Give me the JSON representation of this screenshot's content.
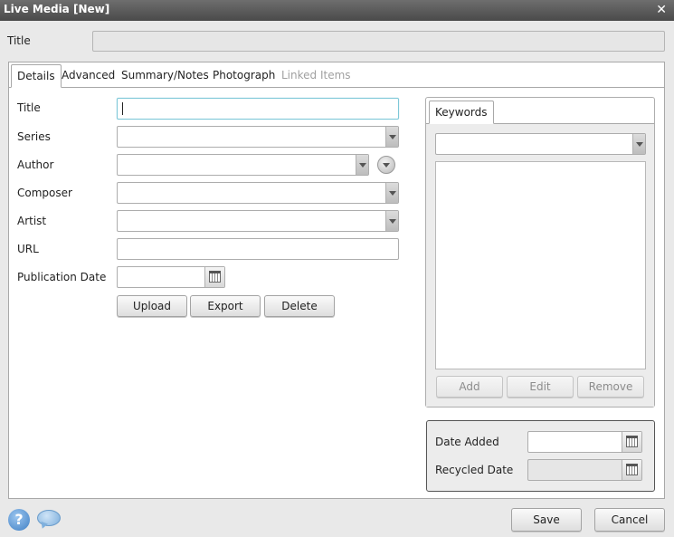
{
  "window": {
    "title": "Live Media [New]",
    "close_glyph": "✕"
  },
  "header": {
    "title_label": "Title",
    "title_value": ""
  },
  "tabs": [
    {
      "label": "Details",
      "state": "active"
    },
    {
      "label": "Advanced",
      "state": "normal"
    },
    {
      "label": "Summary/Notes",
      "state": "normal"
    },
    {
      "label": "Photograph",
      "state": "normal"
    },
    {
      "label": "Linked Items",
      "state": "disabled"
    }
  ],
  "details": {
    "title": {
      "label": "Title",
      "value": ""
    },
    "series": {
      "label": "Series",
      "value": ""
    },
    "author": {
      "label": "Author",
      "value": ""
    },
    "composer": {
      "label": "Composer",
      "value": ""
    },
    "artist": {
      "label": "Artist",
      "value": ""
    },
    "url": {
      "label": "URL",
      "value": ""
    },
    "publication_date": {
      "label": "Publication Date",
      "value": ""
    },
    "buttons": {
      "upload": "Upload",
      "export": "Export",
      "delete": "Delete"
    }
  },
  "keywords": {
    "tab_label": "Keywords",
    "selected": "",
    "items": [],
    "buttons": {
      "add": "Add",
      "edit": "Edit",
      "remove": "Remove"
    }
  },
  "dates": {
    "date_added": {
      "label": "Date Added",
      "value": ""
    },
    "recycled_date": {
      "label": "Recycled Date",
      "value": ""
    }
  },
  "footer": {
    "save": "Save",
    "cancel": "Cancel",
    "help_glyph": "?"
  },
  "icons": {
    "close": "close-icon",
    "dropdown": "chevron-down-icon",
    "calendar": "calendar-icon",
    "help": "help-icon",
    "chat": "chat-bubble-icon"
  },
  "colors": {
    "titlebar": "#555555",
    "focus_border": "#7ec8d8",
    "help": "#3f7fc4"
  }
}
